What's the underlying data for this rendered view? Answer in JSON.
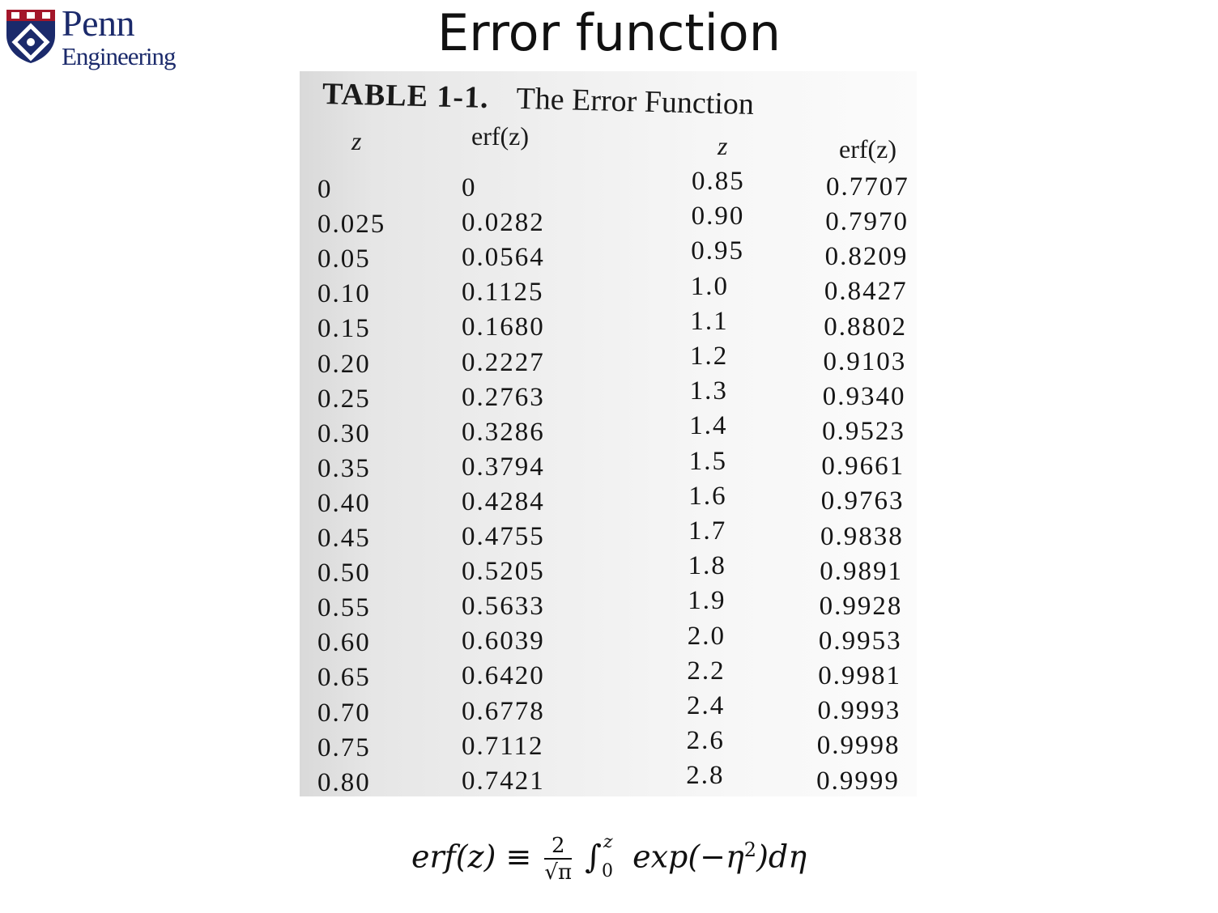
{
  "slide": {
    "title": "Error function"
  },
  "logo": {
    "line1": "Penn",
    "line2": "Engineering",
    "icon": "penn-shield-icon",
    "color": "#1b2a6b"
  },
  "table": {
    "number": "TABLE 1-1.",
    "name": "The Error Function",
    "headers": {
      "z_left": "z",
      "erf_left": "erf(z)",
      "z_right": "z",
      "erf_right": "erf(z)"
    },
    "rows_left": [
      {
        "z": "0",
        "erf": "0"
      },
      {
        "z": "0.025",
        "erf": "0.0282"
      },
      {
        "z": "0.05",
        "erf": "0.0564"
      },
      {
        "z": "0.10",
        "erf": "0.1125"
      },
      {
        "z": "0.15",
        "erf": "0.1680"
      },
      {
        "z": "0.20",
        "erf": "0.2227"
      },
      {
        "z": "0.25",
        "erf": "0.2763"
      },
      {
        "z": "0.30",
        "erf": "0.3286"
      },
      {
        "z": "0.35",
        "erf": "0.3794"
      },
      {
        "z": "0.40",
        "erf": "0.4284"
      },
      {
        "z": "0.45",
        "erf": "0.4755"
      },
      {
        "z": "0.50",
        "erf": "0.5205"
      },
      {
        "z": "0.55",
        "erf": "0.5633"
      },
      {
        "z": "0.60",
        "erf": "0.6039"
      },
      {
        "z": "0.65",
        "erf": "0.6420"
      },
      {
        "z": "0.70",
        "erf": "0.6778"
      },
      {
        "z": "0.75",
        "erf": "0.7112"
      },
      {
        "z": "0.80",
        "erf": "0.7421"
      }
    ],
    "rows_right": [
      {
        "z": "0.85",
        "erf": "0.7707"
      },
      {
        "z": "0.90",
        "erf": "0.7970"
      },
      {
        "z": "0.95",
        "erf": "0.8209"
      },
      {
        "z": "1.0",
        "erf": "0.8427"
      },
      {
        "z": "1.1",
        "erf": "0.8802"
      },
      {
        "z": "1.2",
        "erf": "0.9103"
      },
      {
        "z": "1.3",
        "erf": "0.9340"
      },
      {
        "z": "1.4",
        "erf": "0.9523"
      },
      {
        "z": "1.5",
        "erf": "0.9661"
      },
      {
        "z": "1.6",
        "erf": "0.9763"
      },
      {
        "z": "1.7",
        "erf": "0.9838"
      },
      {
        "z": "1.8",
        "erf": "0.9891"
      },
      {
        "z": "1.9",
        "erf": "0.9928"
      },
      {
        "z": "2.0",
        "erf": "0.9953"
      },
      {
        "z": "2.2",
        "erf": "0.9981"
      },
      {
        "z": "2.4",
        "erf": "0.9993"
      },
      {
        "z": "2.6",
        "erf": "0.9998"
      },
      {
        "z": "2.8",
        "erf": "0.9999"
      }
    ]
  },
  "formula": {
    "lhs": "erf(z)",
    "equiv": "≡",
    "coef_num": "2",
    "coef_den": "√π",
    "integral": "∫",
    "upper": "z",
    "lower": "0",
    "integrand": "exp(−η",
    "power": "2",
    "tail": ")dη"
  }
}
